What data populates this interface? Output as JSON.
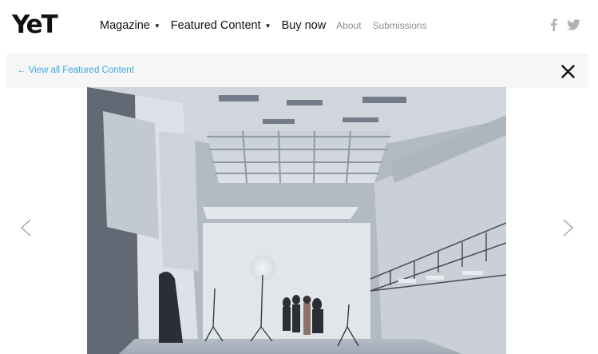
{
  "header": {
    "logo": "YeT",
    "nav": [
      {
        "label": "Magazine",
        "dropdown": true,
        "caret": "▼"
      },
      {
        "label": "Featured Content",
        "dropdown": true,
        "caret": "▼"
      },
      {
        "label": "Buy now",
        "dropdown": false
      },
      {
        "label": "About",
        "dropdown": false
      },
      {
        "label": "Submissions",
        "dropdown": false
      }
    ],
    "social": [
      "facebook-icon",
      "twitter-icon"
    ]
  },
  "subbar": {
    "back_link": "← View all Featured Content",
    "close_icon": "close-icon"
  },
  "gallery": {
    "image": "photo-studio-interior",
    "prev_icon": "chevron-left-icon",
    "next_icon": "chevron-right-icon"
  },
  "colors": {
    "accent": "#3aa8dd",
    "text": "#111111",
    "muted_nav": "#8c8c8c",
    "subbar_bg": "#f6f6f6"
  }
}
